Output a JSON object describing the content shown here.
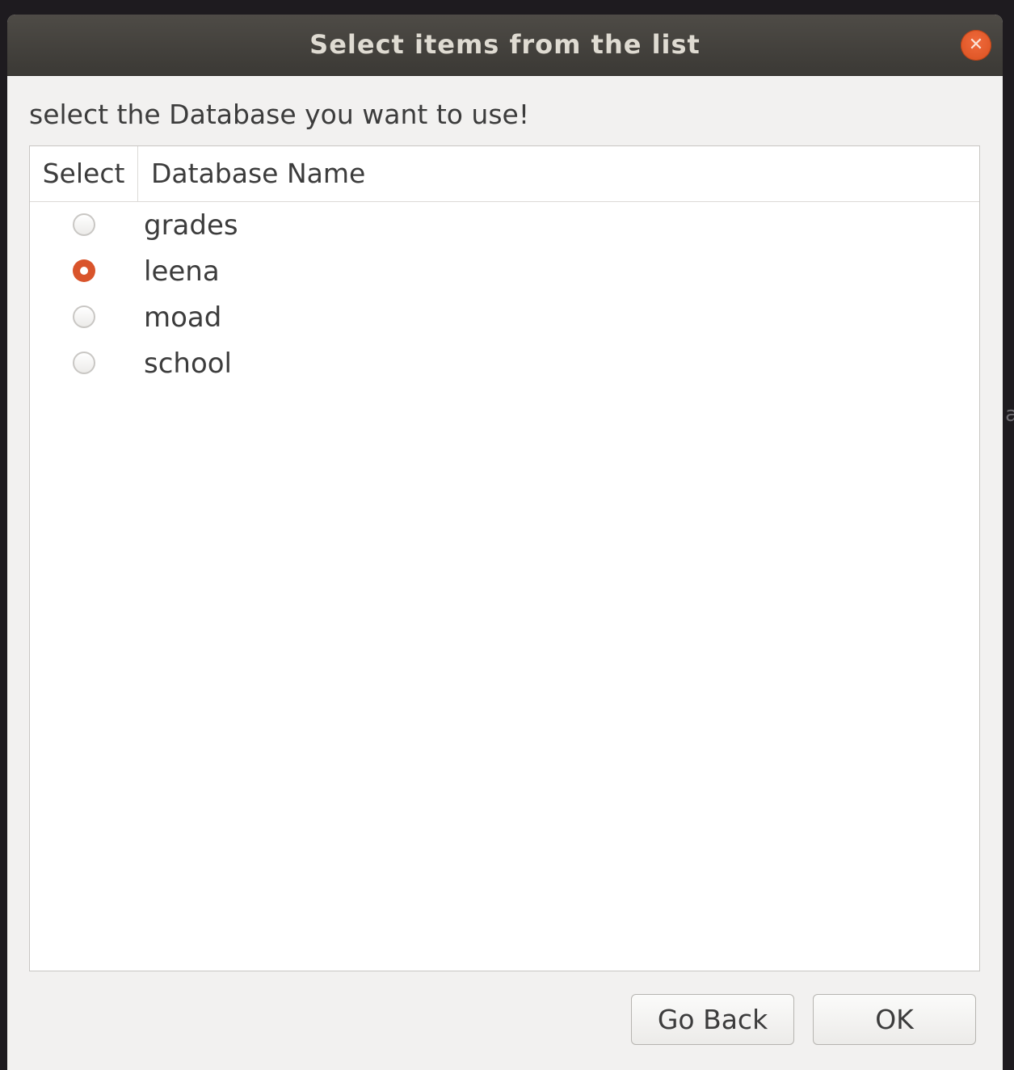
{
  "window": {
    "title": "Select items from the list",
    "close_glyph": "✕",
    "close_icon": "close-icon"
  },
  "prompt": "select  the Database you want to use!",
  "table": {
    "columns": [
      "Select",
      "Database Name"
    ],
    "rows": [
      {
        "name": "grades",
        "selected": false
      },
      {
        "name": "leena",
        "selected": true
      },
      {
        "name": "moad",
        "selected": false
      },
      {
        "name": "school",
        "selected": false
      }
    ]
  },
  "buttons": {
    "go_back": "Go Back",
    "ok": "OK"
  },
  "edge_glyph": "a",
  "colors": {
    "accent": "#d9542b",
    "titlebar": "#3b3935",
    "title_text": "#dfdbd2"
  }
}
